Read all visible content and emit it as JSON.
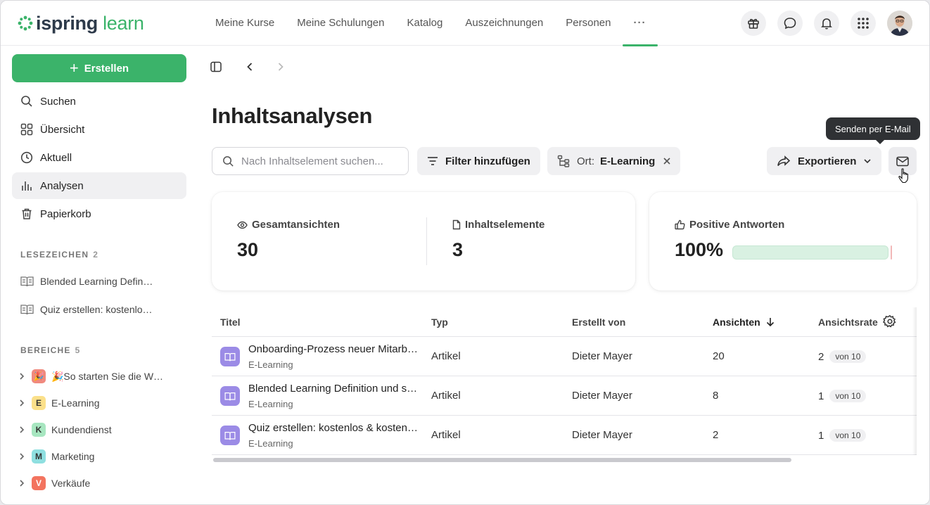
{
  "header": {
    "logo_word1": "ispring",
    "logo_word2": "learn",
    "nav": [
      "Meine Kurse",
      "Meine Schulungen",
      "Katalog",
      "Auszeichnungen",
      "Personen"
    ],
    "more_label": "···",
    "icons": [
      "gift-icon",
      "chat-icon",
      "bell-icon",
      "apps-grid-icon",
      "user-avatar"
    ]
  },
  "sidebar": {
    "create_label": "Erstellen",
    "items": [
      {
        "label": "Suchen",
        "icon": "search-icon"
      },
      {
        "label": "Übersicht",
        "icon": "grid-icon"
      },
      {
        "label": "Aktuell",
        "icon": "clock-icon"
      },
      {
        "label": "Analysen",
        "icon": "bar-chart-icon",
        "active": true
      },
      {
        "label": "Papierkorb",
        "icon": "trash-icon"
      }
    ],
    "bookmarks_title": "LESEZEICHEN",
    "bookmarks_count": "2",
    "bookmarks": [
      "Blended Learning Defin…",
      "Quiz erstellen: kostenlo…"
    ],
    "areas_title": "BEREICHE",
    "areas_count": "5",
    "areas": [
      {
        "badge": "🎉",
        "label": "🎉So starten Sie die W…",
        "color": "#f08a7e"
      },
      {
        "badge": "E",
        "label": "E-Learning",
        "color": "#fbe08a"
      },
      {
        "badge": "K",
        "label": "Kundendienst",
        "color": "#a7e6c0"
      },
      {
        "badge": "M",
        "label": "Marketing",
        "color": "#8fdfe0"
      },
      {
        "badge": "V",
        "label": "Verkäufe",
        "color": "#f3745f"
      }
    ]
  },
  "main": {
    "title": "Inhaltsanalysen",
    "search_placeholder": "Nach Inhaltselement suchen...",
    "filter_label": "Filter hinzufügen",
    "location_label": "Ort:",
    "location_value": "E-Learning",
    "export_label": "Exportieren",
    "tooltip": "Senden per E-Mail"
  },
  "metrics": {
    "views_label": "Gesamtansichten",
    "views_value": "30",
    "items_label": "Inhaltselemente",
    "items_value": "3",
    "positive_label": "Positive Antworten",
    "positive_value": "100%",
    "positive_fraction": 1.0
  },
  "table": {
    "headers": {
      "title": "Titel",
      "type": "Typ",
      "created_by": "Erstellt von",
      "views": "Ansichten",
      "rate": "Ansichtsrate"
    },
    "rows": [
      {
        "title": "Onboarding-Prozess neuer Mitarb…",
        "location": "E-Learning",
        "type": "Artikel",
        "author": "Dieter Mayer",
        "views": "20",
        "rate": "2",
        "rate_of": "von 10"
      },
      {
        "title": "Blended Learning Definition und s…",
        "location": "E-Learning",
        "type": "Artikel",
        "author": "Dieter Mayer",
        "views": "8",
        "rate": "1",
        "rate_of": "von 10"
      },
      {
        "title": "Quiz erstellen: kostenlos & kosten…",
        "location": "E-Learning",
        "type": "Artikel",
        "author": "Dieter Mayer",
        "views": "2",
        "rate": "1",
        "rate_of": "von 10"
      }
    ]
  },
  "colors": {
    "accent": "#3bb36a",
    "row_icon": "#9b8be6",
    "progress": "#d9f1e2"
  }
}
